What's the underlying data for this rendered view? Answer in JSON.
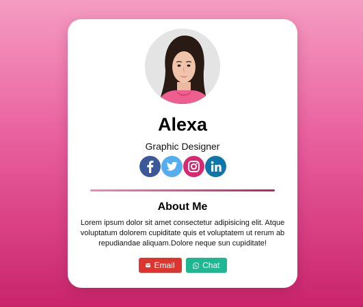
{
  "profile": {
    "name": "Alexa",
    "role": "Graphic Designer"
  },
  "socials": [
    {
      "network": "facebook",
      "icon": "facebook-icon",
      "color": "#3b5998"
    },
    {
      "network": "twitter",
      "icon": "twitter-icon",
      "color": "#55acee"
    },
    {
      "network": "instagram",
      "icon": "instagram-icon",
      "color": "#d6296f"
    },
    {
      "network": "linkedin",
      "icon": "linkedin-icon",
      "color": "#0e76a8"
    }
  ],
  "about": {
    "title": "About Me",
    "text": "Lorem ipsum dolor sit amet consectetur adipisicing elit. Atque voluptatum dolorem cupiditate quis et voluptatem ut rerum ab repudiandae aliquam.Dolore neque sun cupiditate!"
  },
  "actions": {
    "email_label": "Email",
    "email_icon": "envelope-icon",
    "chat_label": "Chat",
    "chat_icon": "whatsapp-icon"
  },
  "colors": {
    "background_top": "#f59cc2",
    "background_bottom": "#c9246b",
    "email_button": "#dc3530",
    "chat_button": "#1fb791"
  }
}
